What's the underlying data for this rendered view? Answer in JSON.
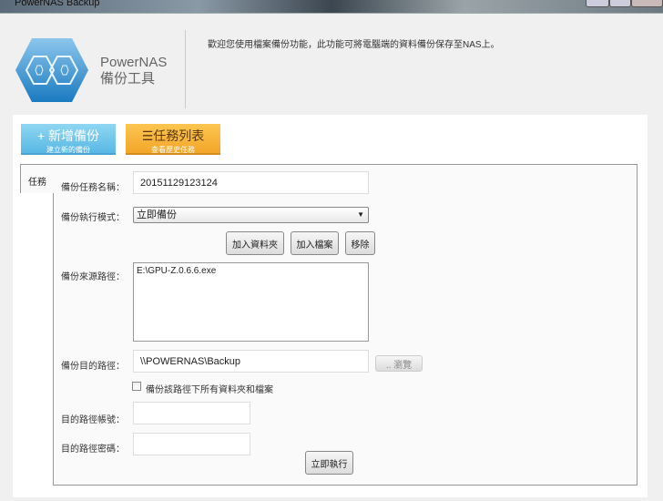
{
  "window": {
    "title": "PowerNAS Backup"
  },
  "brand": {
    "name": "PowerNAS",
    "subtitle": "備份工具"
  },
  "welcome": "歡迎您使用檔案備份功能，此功能可將電腦端的資料備份保存至NAS上。",
  "actions": {
    "new_backup": {
      "label": "+ 新增備份",
      "sub": "建立新的備份"
    },
    "task_list": {
      "label": "任務列表",
      "sub": "查看歷史任務"
    }
  },
  "tab": {
    "label": "任務"
  },
  "form": {
    "task_name_label": "備份任務名稱：",
    "task_name": "20151129123124",
    "mode_label": "備份執行模式：",
    "mode": "立即備份",
    "add_folder": "加入資料夾",
    "add_file": "加入檔案",
    "remove": "移除",
    "source_label": "備份來源路徑：",
    "source": "E:\\GPU-Z.0.6.6.exe",
    "dest_label": "備份目的路徑：",
    "dest": "\\\\POWERNAS\\Backup",
    "browse": ".. 瀏覽",
    "all_sub_label": "備份該路徑下所有資料夾和檔案",
    "account_label": "目的路徑帳號：",
    "account": "",
    "password_label": "目的路徑密碼：",
    "password": "",
    "run": "立即執行"
  }
}
